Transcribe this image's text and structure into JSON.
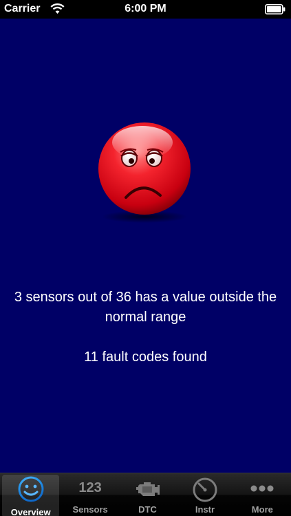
{
  "status_bar": {
    "carrier": "Carrier",
    "time": "6:00 PM",
    "icons": [
      "wifi-icon",
      "battery-icon"
    ]
  },
  "overview": {
    "status_icon": "sad-face-icon",
    "summary": "3 sensors out of 36 has a value outside the normal range",
    "faults": "11 fault codes found",
    "background_color": "#000066",
    "face_color": "#e8101e"
  },
  "tab_bar": {
    "selected": "Overview",
    "tabs": [
      {
        "label": "Overview",
        "icon": "smiley-icon"
      },
      {
        "label": "Sensors",
        "icon": "numbers-icon",
        "glyph": "123"
      },
      {
        "label": "DTC",
        "icon": "engine-icon"
      },
      {
        "label": "Instr",
        "icon": "gauge-icon"
      },
      {
        "label": "More",
        "icon": "more-dots-icon"
      }
    ]
  }
}
